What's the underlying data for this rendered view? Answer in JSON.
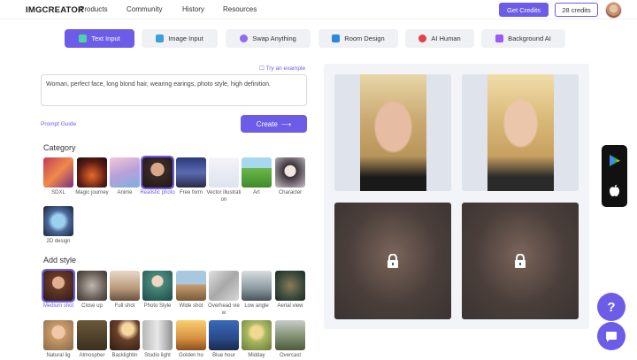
{
  "header": {
    "logo": "IMGCREATOR",
    "nav": [
      "Products",
      "Community",
      "History",
      "Resources"
    ],
    "get_credits": "Get Credits",
    "credits": "28 credits"
  },
  "modes": [
    {
      "label": "Text Input",
      "active": true,
      "icon": "text-input-icon"
    },
    {
      "label": "Image Input",
      "active": false,
      "icon": "image-input-icon"
    },
    {
      "label": "Swap Anything",
      "active": false,
      "icon": "swap-icon"
    },
    {
      "label": "Room Design",
      "active": false,
      "icon": "room-icon"
    },
    {
      "label": "AI Human",
      "active": false,
      "icon": "ai-human-icon"
    },
    {
      "label": "Background AI",
      "active": false,
      "icon": "background-icon"
    }
  ],
  "prompt": {
    "try_example": "Try an example",
    "value": "Woman, perfect face, long blond hair, wearing earings, photo style, high definition.",
    "guide": "Prompt Guide",
    "create": "Create"
  },
  "category": {
    "title": "Category",
    "selected": "Realistic photo",
    "items": [
      "SDXL",
      "Magic journey",
      "Anime",
      "Realistic photo",
      "Free form",
      "Vector illustration",
      "Art",
      "Character",
      "2D design"
    ]
  },
  "style": {
    "title": "Add style",
    "selected": "Medium shot",
    "items": [
      "Medium shot",
      "Close up",
      "Full shot",
      "Photo Style",
      "Wide shot",
      "Overhead view",
      "Low angle",
      "Aerial view",
      "Natural lig",
      "Atmospher",
      "Backlightin",
      "Studio light",
      "Golden ho",
      "Blue hour",
      "Midday",
      "Overcast"
    ]
  },
  "results": {
    "locked_count": 2,
    "lock_icon": "lock-icon"
  },
  "floating": {
    "help": "?",
    "stores": [
      "google-play-icon",
      "apple-icon"
    ]
  },
  "colors": {
    "accent": "#6c5ce7"
  }
}
